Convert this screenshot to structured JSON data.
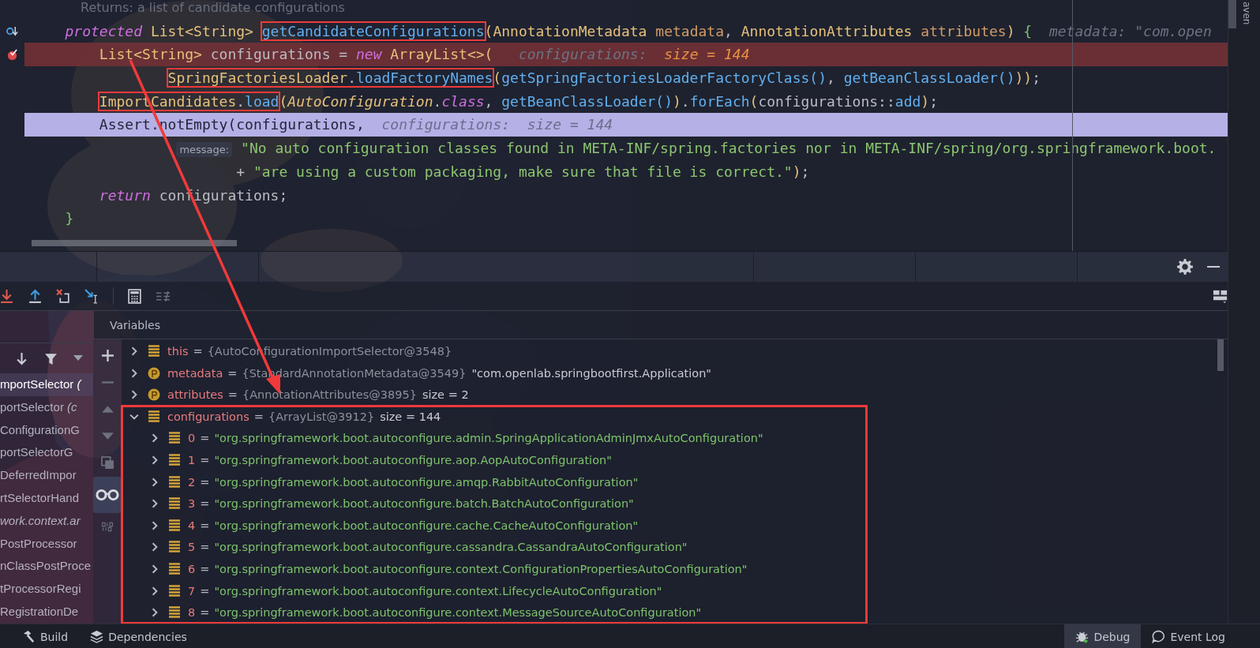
{
  "editor": {
    "lines": [
      {
        "kind": "doc",
        "tokens": [
          {
            "text": "Returns: a list of candidate configurations",
            "kind": "doc"
          }
        ]
      },
      {
        "kind": "normal",
        "tokens": [
          {
            "text": "protected",
            "kind": "keyword"
          },
          {
            "text": " List<String> ",
            "kind": "type"
          },
          {
            "text": "getCandidateConfigurations",
            "kind": "method",
            "annotated": true
          },
          {
            "text": "(",
            "kind": "bracket"
          },
          {
            "text": "AnnotationMetadata",
            "kind": "type"
          },
          {
            "text": " metadata",
            "kind": "param"
          },
          {
            "text": ", ",
            "kind": "plain"
          },
          {
            "text": "AnnotationAttributes",
            "kind": "type"
          },
          {
            "text": " attributes",
            "kind": "param"
          },
          {
            "text": ") ",
            "kind": "bracket"
          },
          {
            "text": "{",
            "kind": "brace"
          },
          {
            "text": "  metadata: \"com.open",
            "kind": "hint"
          }
        ]
      },
      {
        "kind": "breakpoint",
        "tokens": [
          {
            "text": "    List<String>",
            "kind": "type"
          },
          {
            "text": " configurations = ",
            "kind": "plain"
          },
          {
            "text": "new",
            "kind": "keyword"
          },
          {
            "text": " ArrayList<>",
            "kind": "type"
          },
          {
            "text": "(",
            "kind": "bracket"
          },
          {
            "text": "   configurations: ",
            "kind": "hint"
          },
          {
            "text": " size = 144",
            "kind": "hint_value"
          }
        ]
      },
      {
        "kind": "normal",
        "tokens": [
          {
            "annotated": true,
            "tokens": [
              {
                "text": "            SpringFactoriesLoader",
                "kind": "type"
              },
              {
                "text": ".",
                "kind": "plain"
              },
              {
                "text": "loadFactoryNames",
                "kind": "method"
              }
            ]
          },
          {
            "text": "(",
            "kind": "bracket"
          },
          {
            "text": "getSpringFactoriesLoaderFactoryClass",
            "kind": "method"
          },
          {
            "text": "()",
            "kind": "paren"
          },
          {
            "text": ", ",
            "kind": "plain"
          },
          {
            "text": "getBeanClassLoader",
            "kind": "method"
          },
          {
            "text": "()",
            "kind": "paren"
          },
          {
            "text": "))",
            "kind": "bracket"
          },
          {
            "text": ";",
            "kind": "plain"
          }
        ]
      },
      {
        "kind": "normal",
        "tokens": [
          {
            "annotated": true,
            "tokens": [
              {
                "text": "    ImportCandidates",
                "kind": "type"
              },
              {
                "text": ".",
                "kind": "plain"
              },
              {
                "text": "load",
                "kind": "method"
              }
            ]
          },
          {
            "text": "(",
            "kind": "bracket"
          },
          {
            "text": "AutoConfiguration",
            "kind": "type_italic"
          },
          {
            "text": ".",
            "kind": "plain"
          },
          {
            "text": "class",
            "kind": "keyword"
          },
          {
            "text": ", ",
            "kind": "plain"
          },
          {
            "text": "getBeanClassLoader",
            "kind": "method"
          },
          {
            "text": "()",
            "kind": "paren"
          },
          {
            "text": ")",
            "kind": "bracket"
          },
          {
            "text": ".",
            "kind": "plain"
          },
          {
            "text": "forEach",
            "kind": "method"
          },
          {
            "text": "(",
            "kind": "bracket"
          },
          {
            "text": "configurations::",
            "kind": "plain"
          },
          {
            "text": "add",
            "kind": "method"
          },
          {
            "text": ")",
            "kind": "bracket"
          },
          {
            "text": ";",
            "kind": "plain"
          }
        ]
      },
      {
        "kind": "current",
        "tokens": [
          {
            "text": "    Assert.notEmpty(configurations,",
            "kind": "plain"
          },
          {
            "text": "  configurations:  size = 144",
            "kind": "hint"
          }
        ]
      },
      {
        "kind": "normal",
        "tokens": [
          {
            "text": "             message:",
            "kind": "param_hint"
          },
          {
            "text": " \"No auto configuration classes found in META-INF/spring.factories nor in META-INF/spring/org.springframework.boot.",
            "kind": "string"
          }
        ]
      },
      {
        "kind": "normal",
        "tokens": [
          {
            "text": "                    + ",
            "kind": "plain"
          },
          {
            "text": "\"are using a custom packaging, make sure that file is correct.\"",
            "kind": "string"
          },
          {
            "text": ")",
            "kind": "bracket"
          },
          {
            "text": ";",
            "kind": "plain"
          }
        ]
      },
      {
        "kind": "normal",
        "tokens": [
          {
            "text": "    return",
            "kind": "keyword"
          },
          {
            "text": " configurations;",
            "kind": "plain"
          }
        ]
      },
      {
        "kind": "normal",
        "tokens": [
          {
            "text": "}",
            "kind": "brace"
          }
        ]
      }
    ]
  },
  "side_strip": {
    "label": "aven"
  },
  "debugger": {
    "frames": [
      {
        "text": "mportSelector *(*",
        "selected": true
      },
      {
        "text": "portSelector *(c*",
        "selected": false
      },
      {
        "text": "ConfigurationG",
        "selected": false
      },
      {
        "text": "portSelectorG",
        "selected": false
      },
      {
        "text": "DeferredImpor",
        "selected": false
      },
      {
        "text": "rtSelectorHand",
        "selected": false
      },
      {
        "text": "*work.context.ar*",
        "selected": false
      },
      {
        "text": "PostProcessor",
        "selected": false
      },
      {
        "text": "nClassPostProce",
        "selected": false
      },
      {
        "text": "tProcessorRegi",
        "selected": false
      },
      {
        "text": "RegistrationDe",
        "selected": false
      }
    ],
    "variables_title": "Variables",
    "variables": [
      {
        "name": "this",
        "sign": "=",
        "kind": "field",
        "expanded": false,
        "reference": "{AutoConfigurationImportSelector@3548}"
      },
      {
        "name": "metadata",
        "sign": "=",
        "kind": "param",
        "expanded": false,
        "reference": "{StandardAnnotationMetadata@3549}",
        "value": "\"com.openlab.springbootfirst.Application\""
      },
      {
        "name": "attributes",
        "sign": "=",
        "kind": "param",
        "expanded": false,
        "reference": "{AnnotationAttributes@3895}",
        "value": "size = 2"
      },
      {
        "name": "configurations",
        "sign": "=",
        "kind": "field",
        "expanded": true,
        "annotated": true,
        "reference": "{ArrayList@3912}",
        "value": "size = 144",
        "children": [
          {
            "name": "0",
            "sign": "=",
            "kind": "field",
            "expanded": false,
            "value": "\"org.springframework.boot.autoconfigure.admin.SpringApplicationAdminJmxAutoConfiguration\""
          },
          {
            "name": "1",
            "sign": "=",
            "kind": "field",
            "expanded": false,
            "value": "\"org.springframework.boot.autoconfigure.aop.AopAutoConfiguration\""
          },
          {
            "name": "2",
            "sign": "=",
            "kind": "field",
            "expanded": false,
            "value": "\"org.springframework.boot.autoconfigure.amqp.RabbitAutoConfiguration\""
          },
          {
            "name": "3",
            "sign": "=",
            "kind": "field",
            "expanded": false,
            "value": "\"org.springframework.boot.autoconfigure.batch.BatchAutoConfiguration\""
          },
          {
            "name": "4",
            "sign": "=",
            "kind": "field",
            "expanded": false,
            "value": "\"org.springframework.boot.autoconfigure.cache.CacheAutoConfiguration\""
          },
          {
            "name": "5",
            "sign": "=",
            "kind": "field",
            "expanded": false,
            "value": "\"org.springframework.boot.autoconfigure.cassandra.CassandraAutoConfiguration\""
          },
          {
            "name": "6",
            "sign": "=",
            "kind": "field",
            "expanded": false,
            "value": "\"org.springframework.boot.autoconfigure.context.ConfigurationPropertiesAutoConfiguration\""
          },
          {
            "name": "7",
            "sign": "=",
            "kind": "field",
            "expanded": false,
            "value": "\"org.springframework.boot.autoconfigure.context.LifecycleAutoConfiguration\""
          },
          {
            "name": "8",
            "sign": "=",
            "kind": "field",
            "expanded": false,
            "value": "\"org.springframework.boot.autoconfigure.context.MessageSourceAutoConfiguration\""
          }
        ]
      }
    ]
  },
  "status_bar": {
    "left_tools": [
      {
        "label": "Build"
      },
      {
        "label": "Dependencies"
      }
    ],
    "right_tools": [
      {
        "label": "Debug",
        "selected": true
      },
      {
        "label": "Event Log",
        "selected": false
      }
    ]
  }
}
